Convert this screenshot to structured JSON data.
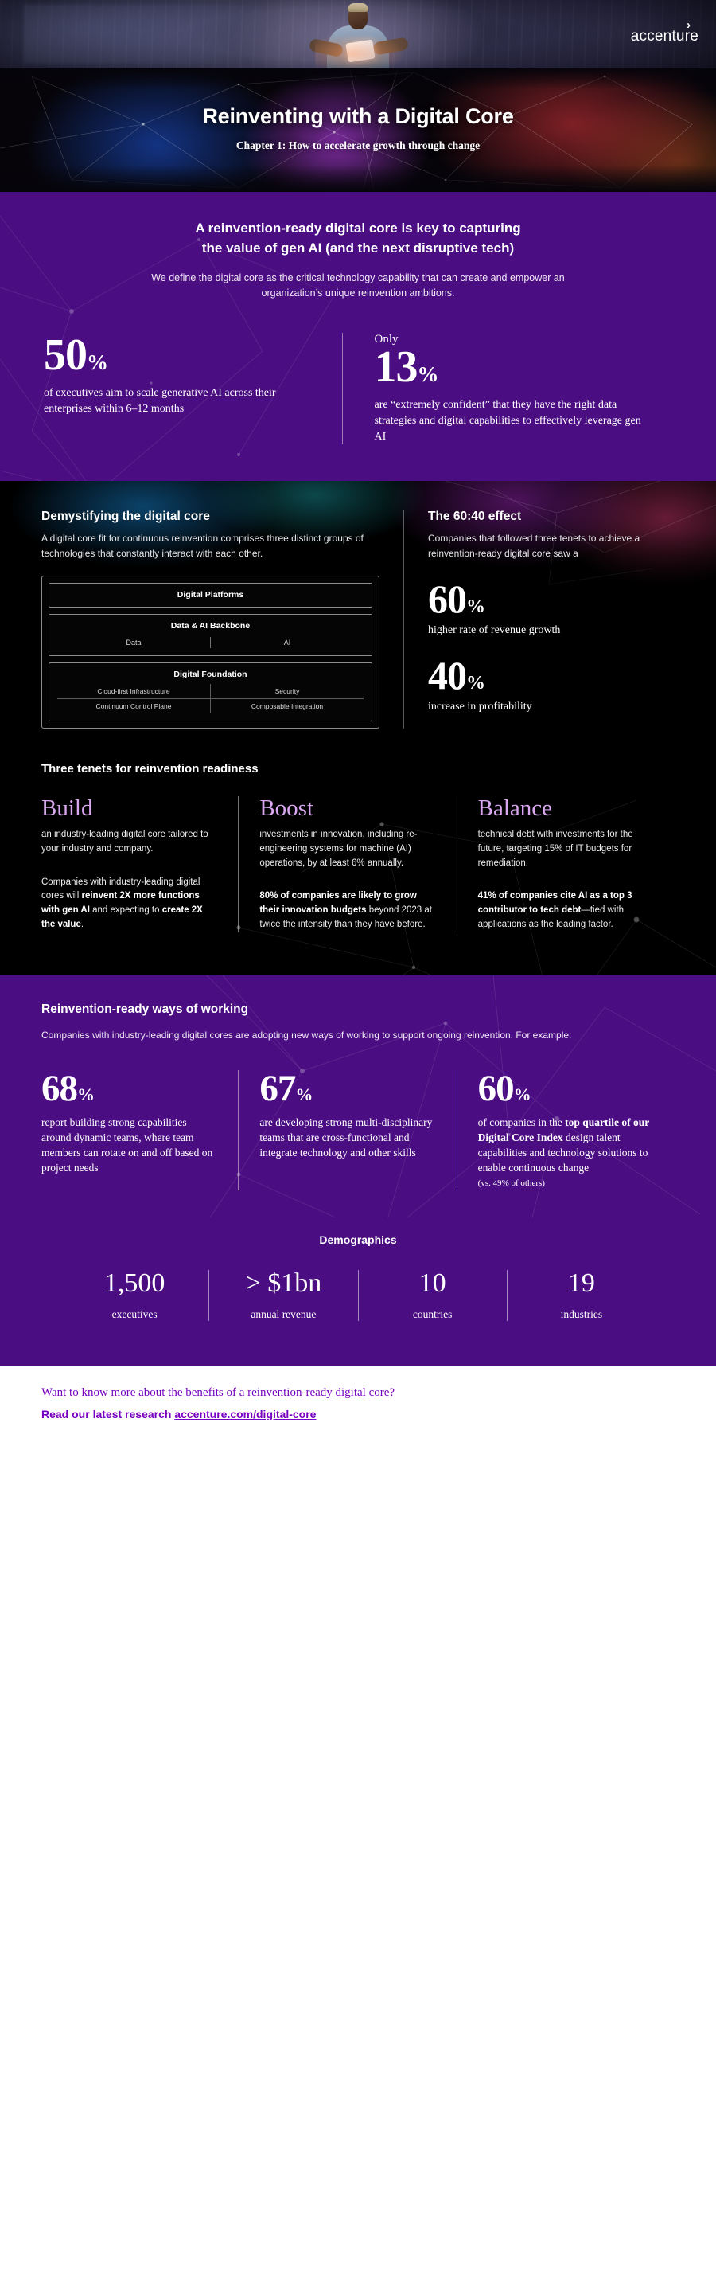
{
  "brand": {
    "logo_word": "accenture",
    "logo_chevron": "›",
    "accent_purple": "#4b0e82",
    "link_purple": "#7500c0",
    "tenet_pink": "#d9a6f0"
  },
  "hero": {
    "title": "Reinventing with a Digital Core",
    "subtitle": "Chapter 1: How to accelerate growth through change"
  },
  "intro": {
    "heading_line1": "A reinvention-ready digital core is key to capturing",
    "heading_line2": "the value of gen AI (and the next disruptive tech)",
    "lede": "We define the digital core as the critical technology capability that can create and empower an organization’s unique reinvention ambitions.",
    "stats": [
      {
        "prefix": "",
        "number": "50",
        "unit": "%",
        "description": "of executives aim to scale generative AI across their enterprises within 6–12 months"
      },
      {
        "prefix": "Only",
        "number": "13",
        "unit": "%",
        "description": "are “extremely confident” that they have the right data strategies and digital capabilities to effectively leverage gen AI"
      }
    ]
  },
  "demystify": {
    "heading": "Demystifying the digital core",
    "body": "A digital core fit for continuous reinvention comprises three distinct groups of technologies that constantly interact with each other.",
    "diagram": {
      "layers": [
        {
          "title": "Digital Platforms",
          "cells": []
        },
        {
          "title": "Data & AI Backbone",
          "cells": [
            "Data",
            "AI"
          ]
        },
        {
          "title": "Digital Foundation",
          "rows": [
            [
              "Cloud-first Infrastructure",
              "Security"
            ],
            [
              "Continuum Control Plane",
              "Composable Integration"
            ]
          ]
        }
      ]
    }
  },
  "effect": {
    "heading": "The 60:40 effect",
    "body": "Companies that followed three tenets to achieve a reinvention-ready digital core saw a",
    "stats": [
      {
        "number": "60",
        "unit": "%",
        "label": "higher rate of revenue growth"
      },
      {
        "number": "40",
        "unit": "%",
        "label": "increase in profitability"
      }
    ]
  },
  "tenets": {
    "heading": "Three tenets for reinvention readiness",
    "items": [
      {
        "name": "Build",
        "text": "an industry-leading digital core tailored to your industry and company.",
        "stat_html": "Companies with industry-leading digital cores will <b>reinvent 2X more functions with gen AI</b> and expecting to <b>create 2X the value</b>."
      },
      {
        "name": "Boost",
        "text": "investments in innovation, including re-engineering systems for machine (AI) operations, by at least 6% annually.",
        "stat_html": "<b>80% of companies are likely to grow their innovation budgets</b> beyond 2023 at twice the intensity than they have before."
      },
      {
        "name": "Balance",
        "text": "technical debt with investments for the future, targeting 15% of IT budgets for remediation.",
        "stat_html": "<b>41% of companies cite AI as a top 3 contributor to tech debt</b>—tied with applications as the leading factor."
      }
    ]
  },
  "ways_of_working": {
    "heading": "Reinvention-ready ways of working",
    "lede": "Companies with industry-leading digital cores are adopting new ways of working to support ongoing reinvention. For example:",
    "stats": [
      {
        "number": "68",
        "unit": "%",
        "description_html": "report building strong capabilities around dynamic teams, where team members can rotate on and off based on project needs"
      },
      {
        "number": "67",
        "unit": "%",
        "description_html": "are developing strong multi-disciplinary teams that are cross-functional and integrate technology and other skills"
      },
      {
        "number": "60",
        "unit": "%",
        "description_html": "of companies in the <b>top quartile of our Digital Core Index</b> design talent capabilities and technology solutions to enable continuous change <span class=\"small\">(vs. 49% of others)</span>"
      }
    ]
  },
  "demographics": {
    "title": "Demographics",
    "items": [
      {
        "value": "1,500",
        "label": "executives"
      },
      {
        "value": "> $1bn",
        "label": "annual revenue"
      },
      {
        "value": "10",
        "label": "countries"
      },
      {
        "value": "19",
        "label": "industries"
      }
    ]
  },
  "footer": {
    "question": "Want to know more about the benefits of a reinvention-ready digital core?",
    "cta_prefix": "Read our latest research ",
    "cta_link": "accenture.com/digital-core"
  }
}
